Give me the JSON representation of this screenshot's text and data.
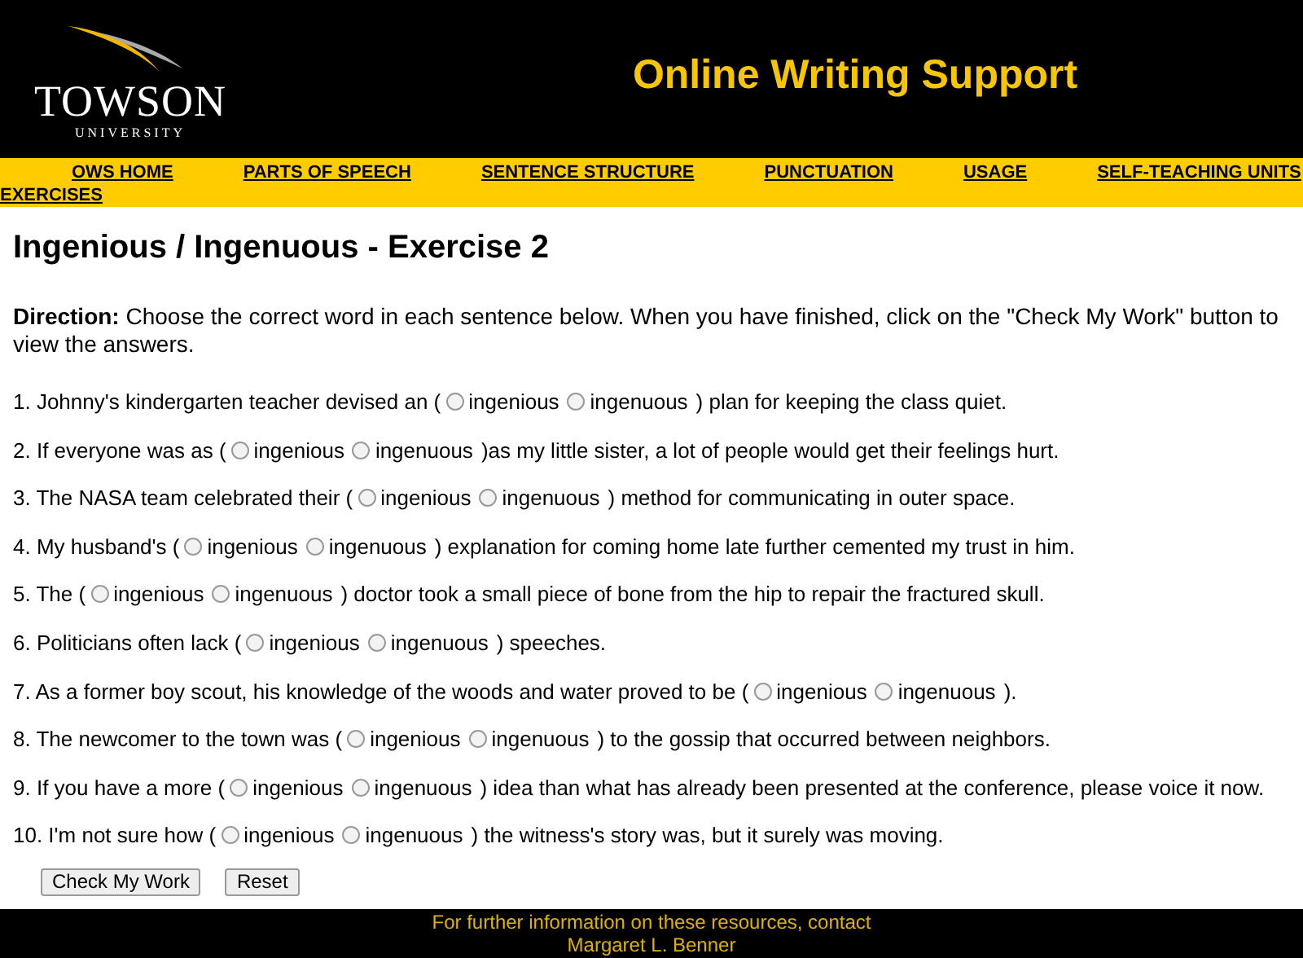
{
  "header": {
    "logo_name": "TOWSON",
    "logo_sub": "UNIVERSITY",
    "title": "Online Writing Support"
  },
  "nav": [
    "OWS HOME",
    "PARTS OF SPEECH",
    "SENTENCE STRUCTURE",
    "PUNCTUATION",
    "USAGE",
    "SELF-TEACHING UNITS",
    "EXERCISES"
  ],
  "page_title": "Ingenious / Ingenuous - Exercise 2",
  "direction": "**Direction:** Choose the correct word in each sentence below. When you have finished, click on the \"Check My Work\" button to view the answers.",
  "questions": [
    {
      "before": "1. Johnny's kindergarten teacher devised an (",
      "options": [
        {
          "label": "ingenious",
          "selected": false
        },
        {
          "label": "ingenuous",
          "selected": false
        }
      ],
      "after": ") plan for keeping the class quiet."
    },
    {
      "before": "2. If everyone was as (",
      "options": [
        {
          "label": "ingenious",
          "selected": false
        },
        {
          "label": "ingenuous",
          "selected": false
        }
      ],
      "after": ")as my little sister, a lot of people would get their feelings hurt."
    },
    {
      "before": "3. The NASA team celebrated their (",
      "options": [
        {
          "label": "ingenious",
          "selected": false
        },
        {
          "label": "ingenuous",
          "selected": false
        }
      ],
      "after": ") method for communicating in outer space."
    },
    {
      "before": "4. My husband's (",
      "options": [
        {
          "label": "ingenious",
          "selected": false
        },
        {
          "label": "ingenuous",
          "selected": false
        }
      ],
      "after": ") explanation for coming home late further cemented my trust in him."
    },
    {
      "before": "5. The (",
      "options": [
        {
          "label": "ingenious",
          "selected": false
        },
        {
          "label": "ingenuous",
          "selected": false
        }
      ],
      "after": ") doctor took a small piece of bone from the hip to repair the fractured skull."
    },
    {
      "before": "6. Politicians often lack (",
      "options": [
        {
          "label": "ingenious",
          "selected": false
        },
        {
          "label": "ingenuous",
          "selected": false
        }
      ],
      "after": ") speeches."
    },
    {
      "before": "7. As a former boy scout, his knowledge of the woods and water proved to be (",
      "options": [
        {
          "label": "ingenious",
          "selected": false
        },
        {
          "label": "ingenuous",
          "selected": false
        }
      ],
      "after": ")."
    },
    {
      "before": "8. The newcomer to the town was (",
      "options": [
        {
          "label": "ingenious",
          "selected": false
        },
        {
          "label": "ingenuous",
          "selected": false
        }
      ],
      "after": ") to the gossip that occurred between neighbors."
    },
    {
      "before": "9. If you have a more (",
      "options": [
        {
          "label": "ingenious",
          "selected": false
        },
        {
          "label": "ingenuous",
          "selected": false
        }
      ],
      "after": ") idea than what has already been presented at the conference, please voice it now."
    },
    {
      "before": "10. I'm not sure how (",
      "options": [
        {
          "label": "ingenious",
          "selected": false
        },
        {
          "label": "ingenuous",
          "selected": false
        }
      ],
      "after": ") the witness's story was, but it surely was moving."
    }
  ],
  "buttons": [
    "Check My Work",
    "Reset"
  ],
  "footer": [
    "For further information on these resources, contact",
    "Margaret L. Benner"
  ]
}
